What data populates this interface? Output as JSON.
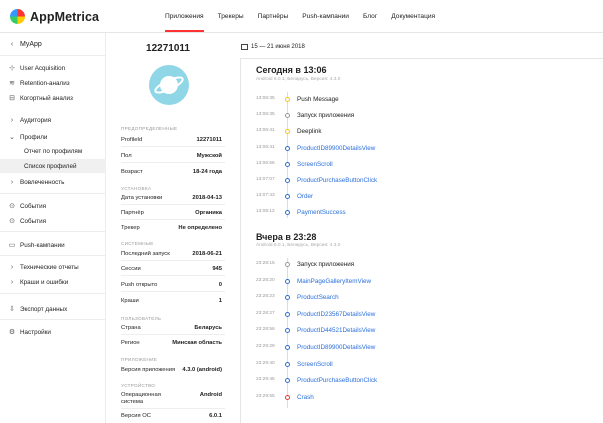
{
  "header": {
    "logo_text": "AppMetrica",
    "nav": [
      {
        "label": "Приложения",
        "active": true
      },
      {
        "label": "Трекеры",
        "active": false
      },
      {
        "label": "Партнёры",
        "active": false
      },
      {
        "label": "Push-кампании",
        "active": false
      },
      {
        "label": "Блог",
        "active": false
      },
      {
        "label": "Документация",
        "active": false
      }
    ]
  },
  "sidebar": {
    "app_name": "MyApp",
    "items": [
      {
        "label": "User Acquisition",
        "icon": "user-acquisition-icon"
      },
      {
        "label": "Retention-анализ",
        "icon": "retention-icon"
      },
      {
        "label": "Когортный анализ",
        "icon": "cohort-icon"
      },
      {
        "label": "Аудитория",
        "icon": "chevron-right-icon"
      },
      {
        "label": "Профили",
        "icon": "chevron-down-icon"
      },
      {
        "label": "Отчет по профилям",
        "icon": ""
      },
      {
        "label": "Список профилей",
        "icon": ""
      },
      {
        "label": "Вовлеченность",
        "icon": "chevron-right-icon"
      },
      {
        "label": "События",
        "icon": "events-icon"
      },
      {
        "label": "События",
        "icon": "events-alt-icon"
      },
      {
        "label": "Push-кампании",
        "icon": "push-icon"
      },
      {
        "label": "Технические отчеты",
        "icon": "chevron-right-icon"
      },
      {
        "label": "Краши и ошибки",
        "icon": "chevron-right-icon"
      },
      {
        "label": "Экспорт данных",
        "icon": "export-icon"
      },
      {
        "label": "Настройки",
        "icon": "settings-icon"
      }
    ]
  },
  "profile": {
    "id": "12271011",
    "avatar_color": "#8fd6e6",
    "sections": [
      {
        "title": "ПРЕДОПРЕДЕЛЕННЫЕ",
        "rows": [
          [
            "ProfileId",
            "12271011"
          ],
          [
            "Пол",
            "Мужской"
          ],
          [
            "Возраст",
            "18-24 года"
          ]
        ]
      },
      {
        "title": "УСТАНОВКА",
        "rows": [
          [
            "Дата установки",
            "2018-04-13"
          ],
          [
            "Партнёр",
            "Органика"
          ],
          [
            "Трекер",
            "Не определено"
          ]
        ]
      },
      {
        "title": "СИСТЕМНЫЕ",
        "rows": [
          [
            "Последний запуск",
            "2018-06-21"
          ],
          [
            "Сессии",
            "945"
          ],
          [
            "Push открыто",
            "0"
          ],
          [
            "Краши",
            "1"
          ]
        ]
      },
      {
        "title": "ПОЛЬЗОВАТЕЛЬ",
        "rows": [
          [
            "Страна",
            "Беларусь"
          ],
          [
            "Регион",
            "Минская область"
          ]
        ]
      },
      {
        "title": "ПРИЛОЖЕНИЕ",
        "rows": [
          [
            "Версия приложения",
            "4.3.0 (android)"
          ]
        ]
      },
      {
        "title": "УСТРОЙСТВО",
        "rows": [
          [
            "Операционная система",
            "Android"
          ],
          [
            "Версия ОС",
            "6.0.1"
          ]
        ]
      }
    ]
  },
  "timeline": {
    "date_range": "15 — 21 июня 2018",
    "days": [
      {
        "title": "Сегодня в 13:06",
        "subtitle": "Android 6.0.1, Беларусь, Версия: 4.3.0",
        "events": [
          {
            "time": "13:06:35",
            "name": "Push Message",
            "color": "#f5c518",
            "link": false
          },
          {
            "time": "13:06:35",
            "name": "Запуск приложения",
            "color": "#999999",
            "link": false
          },
          {
            "time": "13:06:41",
            "name": "Deeplink",
            "color": "#f5c518",
            "link": false
          },
          {
            "time": "13:06:41",
            "name": "ProductID89900DetailsView",
            "color": "#2a6fdb",
            "link": true
          },
          {
            "time": "13:06:56",
            "name": "ScreenScroll",
            "color": "#2a6fdb",
            "link": true
          },
          {
            "time": "13:07:07",
            "name": "ProductPurchaseButtonClick",
            "color": "#2a6fdb",
            "link": true
          },
          {
            "time": "13:07:43",
            "name": "Order",
            "color": "#2a6fdb",
            "link": true
          },
          {
            "time": "13:08:12",
            "name": "PaymentSuccess",
            "color": "#2a6fdb",
            "link": true
          }
        ]
      },
      {
        "title": "Вчера в 23:28",
        "subtitle": "Android 6.0.1, Беларусь, Версия: 4.3.0",
        "events": [
          {
            "time": "23:28:15",
            "name": "Запуск приложения",
            "color": "#999999",
            "link": false
          },
          {
            "time": "23:28:20",
            "name": "MainPageGalleryItemView",
            "color": "#2a6fdb",
            "link": true
          },
          {
            "time": "23:28:23",
            "name": "ProductSearch",
            "color": "#2a6fdb",
            "link": true
          },
          {
            "time": "23:28:27",
            "name": "ProductID23567DetailsView",
            "color": "#2a6fdb",
            "link": true
          },
          {
            "time": "23:28:56",
            "name": "ProductID44521DetailsView",
            "color": "#2a6fdb",
            "link": true
          },
          {
            "time": "23:29:29",
            "name": "ProductID89900DetailsView",
            "color": "#2a6fdb",
            "link": true
          },
          {
            "time": "23:29:40",
            "name": "ScreenScroll",
            "color": "#2a6fdb",
            "link": true
          },
          {
            "time": "23:29:45",
            "name": "ProductPurchaseButtonClick",
            "color": "#2a6fdb",
            "link": true
          },
          {
            "time": "23:29:55",
            "name": "Crash",
            "color": "#e53935",
            "link": true
          }
        ]
      }
    ]
  }
}
